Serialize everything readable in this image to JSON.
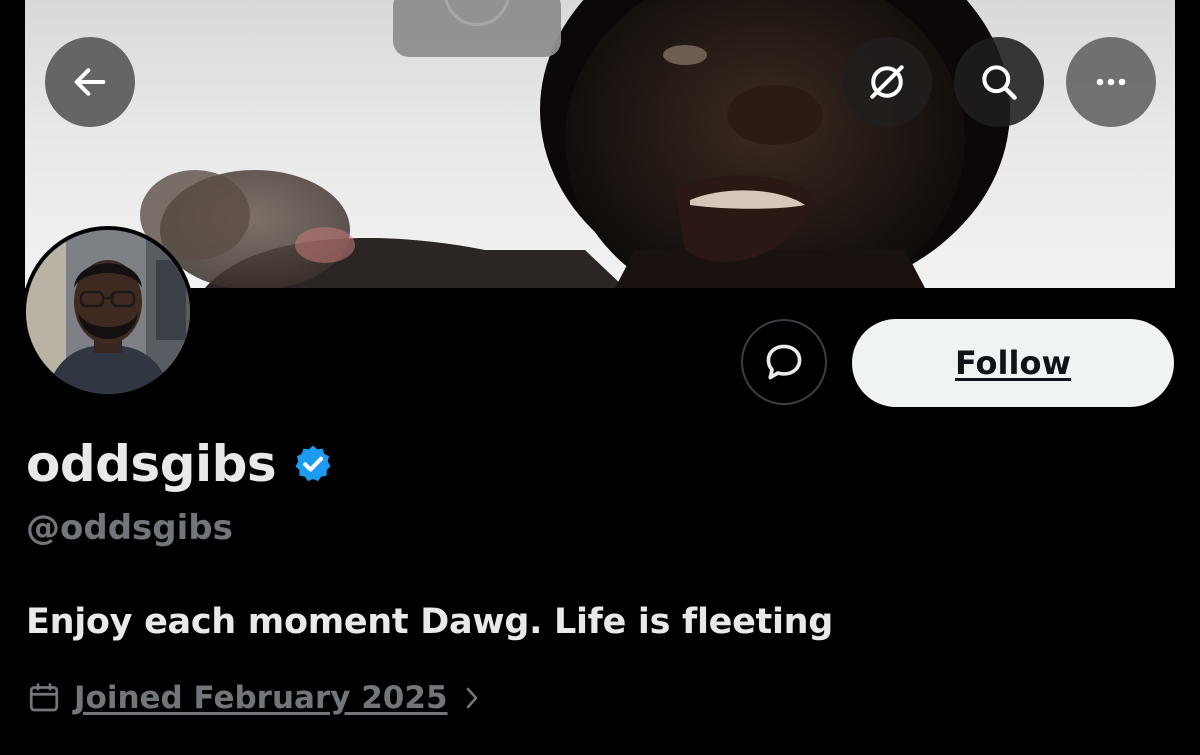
{
  "profile": {
    "display_name": "oddsgibs",
    "handle": "@oddsgibs",
    "bio": "Enjoy each moment Dawg. Life is fleeting",
    "joined": "Joined February 2025",
    "verified": true
  },
  "actions": {
    "follow_label": "Follow"
  },
  "icons": {
    "back": "arrow-left-icon",
    "grok": "grok-icon",
    "search": "search-icon",
    "more": "more-horizontal-icon",
    "message": "message-icon",
    "verified": "verified-badge-icon",
    "calendar": "calendar-icon",
    "chevron": "chevron-right-icon"
  },
  "colors": {
    "background": "#000000",
    "primary_text": "#e7e9ea",
    "secondary_text": "#71767b",
    "verified_blue": "#1d9bf0",
    "follow_bg": "#eff3f4"
  }
}
